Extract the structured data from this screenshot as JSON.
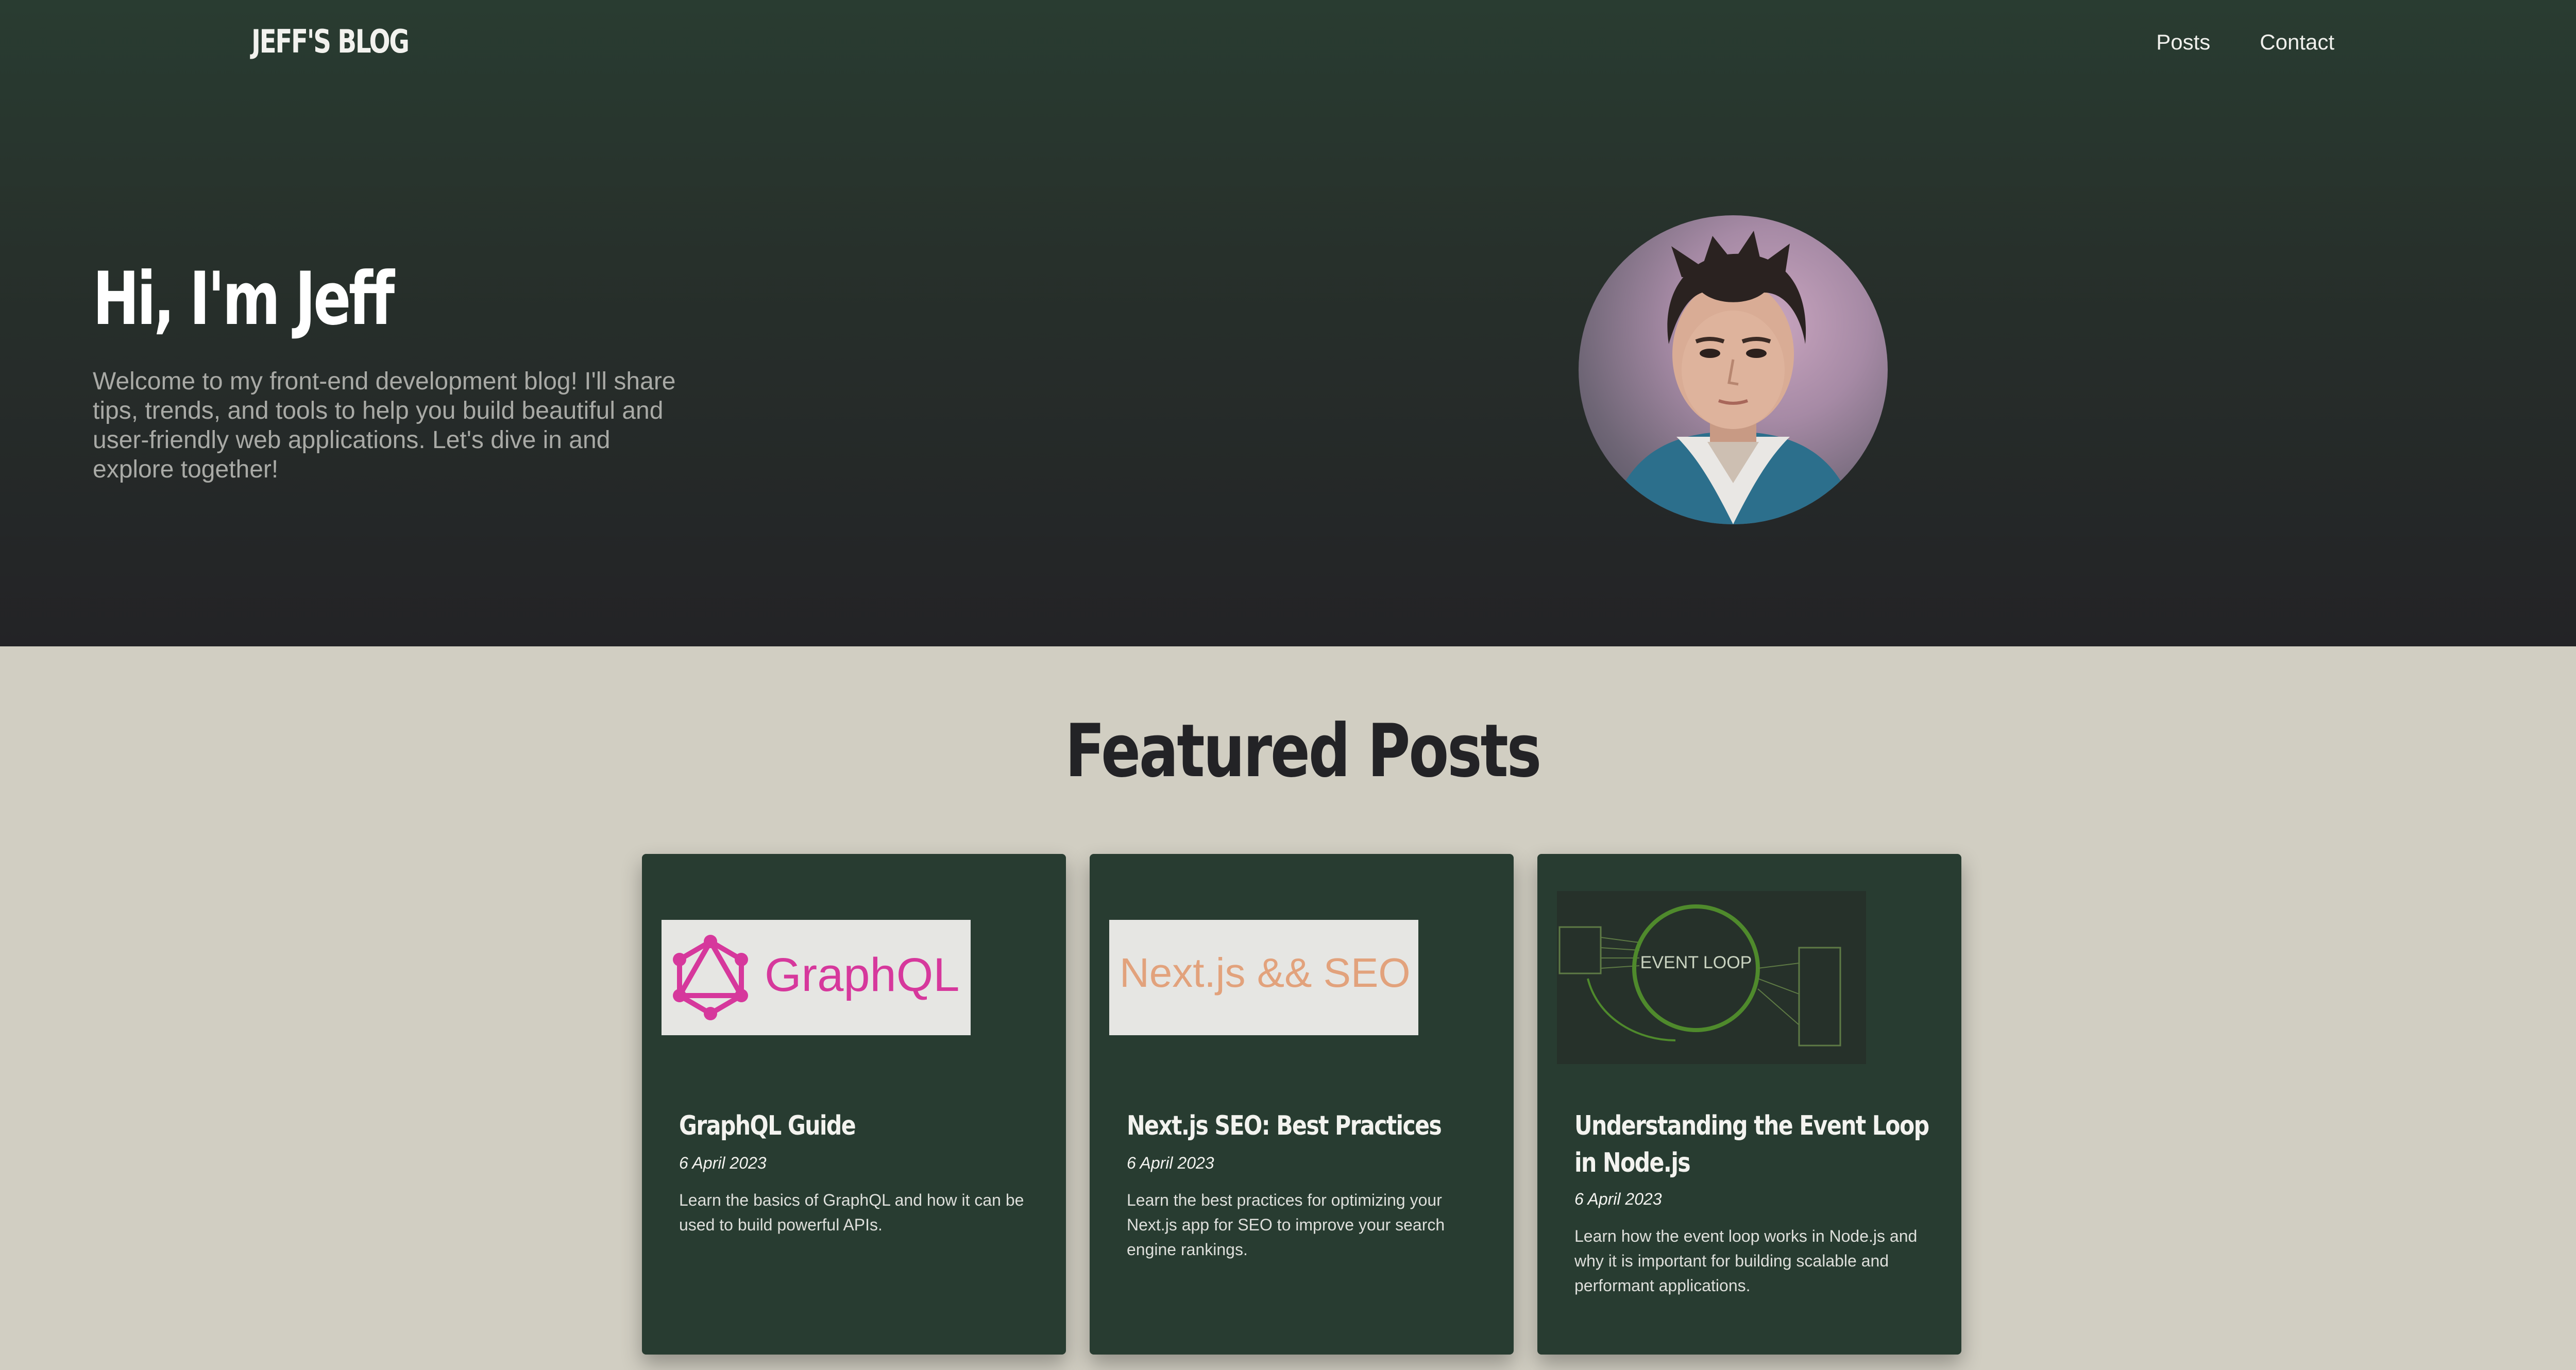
{
  "header": {
    "brand": "JEFF'S BLOG",
    "nav": [
      {
        "label": "Posts"
      },
      {
        "label": "Contact"
      }
    ]
  },
  "hero": {
    "title": "Hi, I'm Jeff",
    "intro": "Welcome to my front-end development blog! I'll share tips, trends, and tools to help you build beautiful and user-friendly web applications. Let's dive in and explore together!"
  },
  "featured": {
    "heading": "Featured Posts",
    "posts": [
      {
        "image_text": "GraphQL",
        "title": "GraphQL Guide",
        "date": "6 April 2023",
        "excerpt": "Learn the basics of GraphQL and how it can be used to build powerful APIs."
      },
      {
        "image_text": "Next.js && SEO",
        "title": "Next.js SEO: Best Practices",
        "date": "6 April 2023",
        "excerpt": "Learn the best practices for optimizing your Next.js app for SEO to improve your search engine rankings."
      },
      {
        "image_text": "EVENT LOOP",
        "title": "Understanding the Event Loop in Node.js",
        "date": "6 April 2023",
        "excerpt": "Learn how the event loop works in Node.js and why it is important for building scalable and performant applications."
      }
    ]
  },
  "colors": {
    "hero_top": "#293c31",
    "hero_bottom": "#232326",
    "page_bg": "#d1cec2",
    "card_bg": "#283c31",
    "graphql_pink": "#d6389c",
    "nextjs_orange": "#e2a27c"
  }
}
